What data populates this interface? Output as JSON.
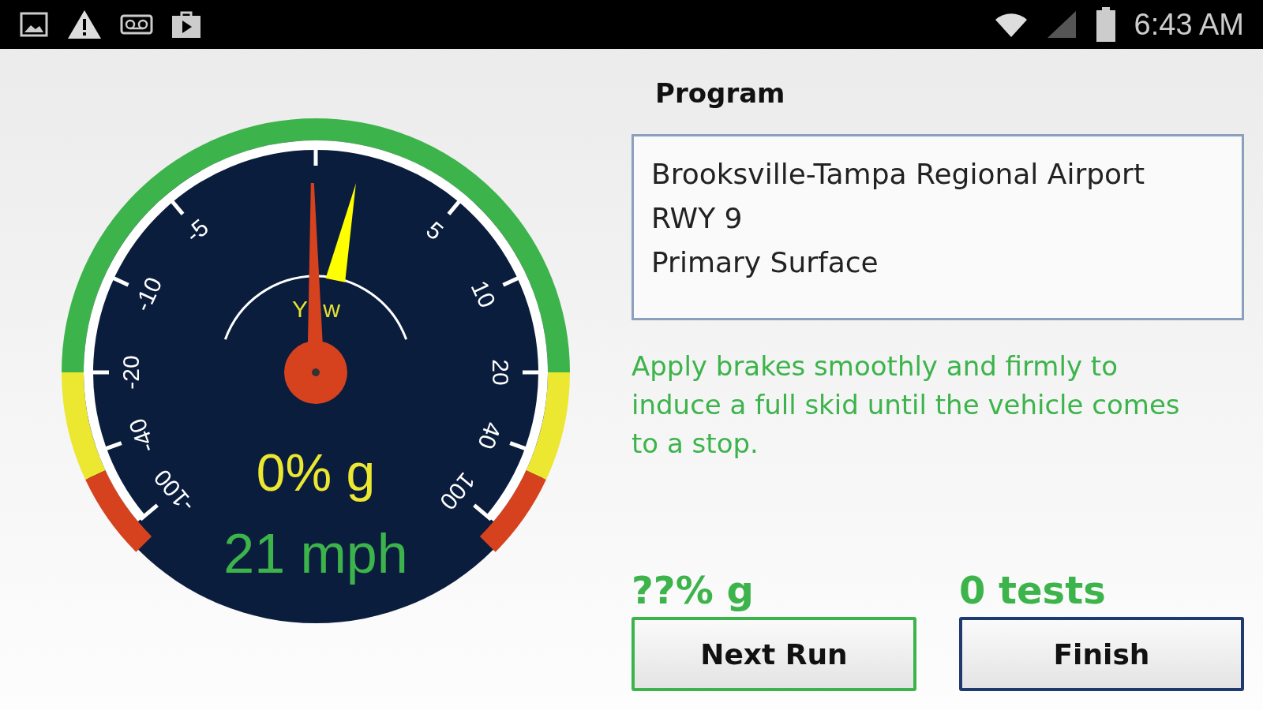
{
  "status_bar": {
    "time": "6:43 AM"
  },
  "gauge": {
    "tick_labels": [
      "-100",
      "-40",
      "-20",
      "-10",
      "-5",
      "5",
      "10",
      "20",
      "40",
      "100"
    ],
    "yaw_letters": [
      "Y",
      "w"
    ],
    "g_reading": "0% g",
    "speed": "21 mph"
  },
  "program": {
    "title": "Program",
    "lines": [
      "Brooksville-Tampa Regional Airport",
      "RWY 9",
      "Primary Surface"
    ]
  },
  "instruction": "Apply brakes smoothly and firmly to induce a full skid until the vehicle comes to a stop.",
  "result": "??% g",
  "tests": "0 tests",
  "buttons": [
    {
      "label": "Next Run",
      "kind": "primary"
    },
    {
      "label": "Finish",
      "kind": "secondary"
    }
  ]
}
